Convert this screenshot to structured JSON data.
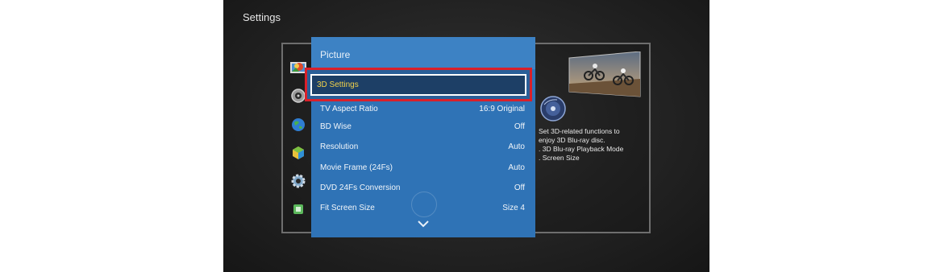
{
  "screen": {
    "title": "Settings"
  },
  "sidebar": {
    "icons": [
      "picture-icon",
      "sound-icon",
      "network-icon",
      "system-icon",
      "settings-icon",
      "support-icon"
    ]
  },
  "panel": {
    "title": "Picture",
    "selected": {
      "label": "3D Settings"
    },
    "items": [
      {
        "label": "TV Aspect Ratio",
        "value": "16:9 Original"
      },
      {
        "label": "BD Wise",
        "value": "Off"
      },
      {
        "label": "Resolution",
        "value": "Auto"
      },
      {
        "label": "Movie Frame (24Fs)",
        "value": "Auto"
      },
      {
        "label": "DVD 24Fs Conversion",
        "value": "Off"
      },
      {
        "label": "Fit Screen Size",
        "value": "Size 4"
      }
    ]
  },
  "info": {
    "lines": [
      "Set 3D-related functions to",
      "enjoy 3D Blu-ray disc.",
      ". 3D Blu-ray Playback Mode",
      ". Screen Size"
    ]
  },
  "colors": {
    "panel_blue": "#2f73b6",
    "selected_bg": "#1d3f66",
    "selected_text": "#f2d24a",
    "highlight_red": "#d9202a"
  }
}
